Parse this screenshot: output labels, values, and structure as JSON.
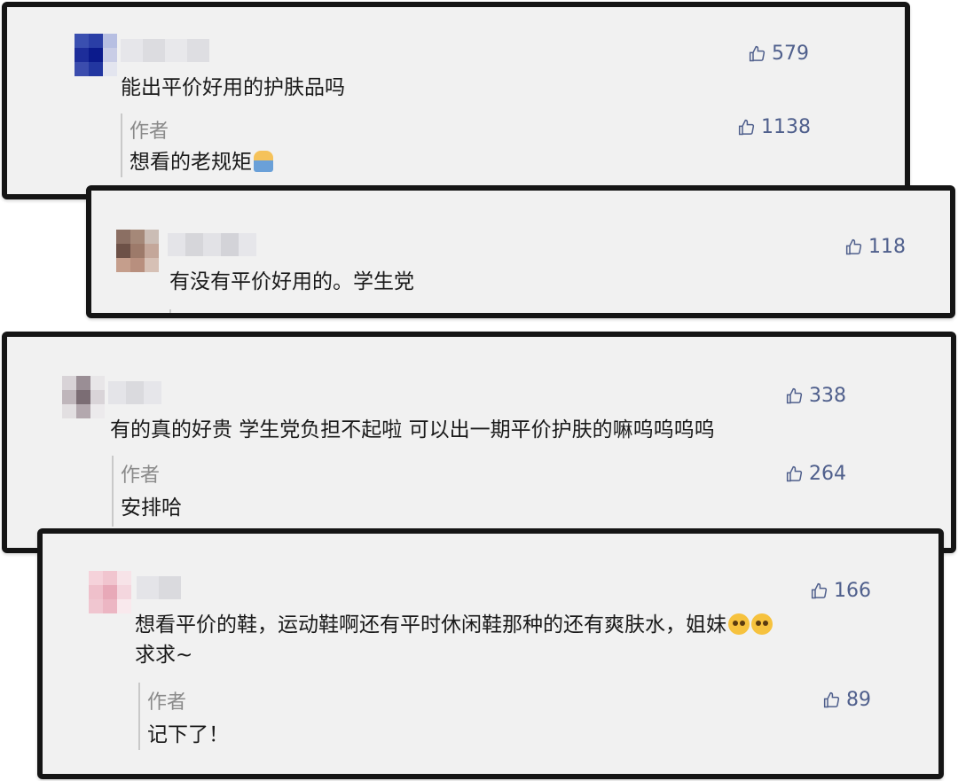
{
  "colors": {
    "like_blue": "#4f5f8c",
    "card_bg": "#f1f1f1",
    "border": "#151515",
    "author_gray": "#8a8a8a"
  },
  "icons": {
    "like": "thumbs-up-icon"
  },
  "comments": [
    {
      "text": "能出平价好用的护肤品吗",
      "likes": "579",
      "reply": {
        "author": "作者",
        "text": "想看的老规矩",
        "likes": "1138",
        "emoji": "person-raising-hand"
      }
    },
    {
      "text": "有没有平价好用的。学生党",
      "likes": "118"
    },
    {
      "text": "有的真的好贵 学生党负担不起啦 可以出一期平价护肤的嘛呜呜呜呜",
      "likes": "338",
      "reply": {
        "author": "作者",
        "text": "安排哈",
        "likes": "264"
      }
    },
    {
      "text_line1": "想看平价的鞋，运动鞋啊还有平时休闲鞋那种的还有爽肤水，姐妹",
      "text_line2": "求求~",
      "emoji": "pleading-face",
      "likes": "166",
      "reply": {
        "author": "作者",
        "text": "记下了！",
        "likes": "89"
      }
    }
  ]
}
